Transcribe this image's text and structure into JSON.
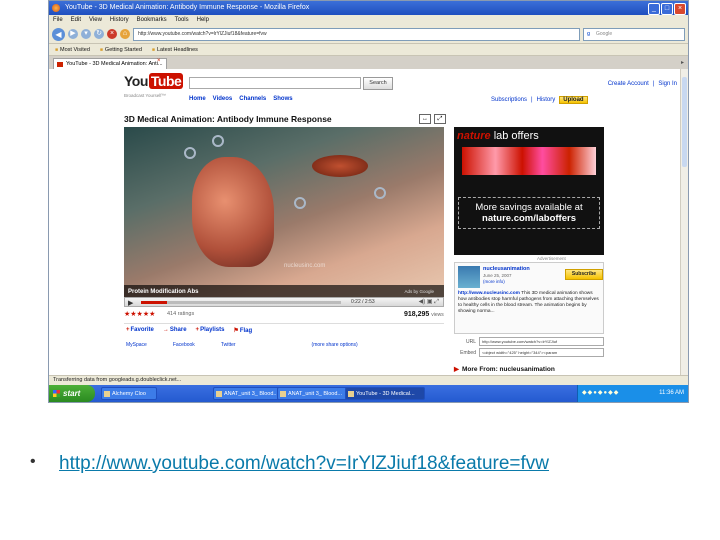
{
  "browser": {
    "title": "YouTube - 3D Medical Animation: Antibody Immune Response - Mozilla Firefox",
    "menu": [
      "File",
      "Edit",
      "View",
      "History",
      "Bookmarks",
      "Tools",
      "Help"
    ],
    "url": "http://www.youtube.com/watch?v=lrYlZJiuf18&feature=fvw",
    "search_placeholder": "Google",
    "bookmarks": [
      "Most Visited",
      "Getting Started",
      "Latest Headlines"
    ],
    "tab_label": "YouTube - 3D Medical Animation: Anti...",
    "status": "Transferring data from googleads.g.doubleclick.net..."
  },
  "youtube": {
    "logo_you": "You",
    "logo_tube": "Tube",
    "tagline": "Broadcast Yourself™",
    "search_button": "Search",
    "nav": [
      "Home",
      "Videos",
      "Channels",
      "Shows"
    ],
    "create_account": "Create Account",
    "sign_in": "Sign In",
    "subscriptions": "Subscriptions",
    "history": "History",
    "upload": "Upload",
    "video_title": "3D Medical Animation: Antibody Immune Response",
    "video_caption": "Protein Modification Abs",
    "ads_by": "Ads by Google",
    "watermark": "nucleusinc.com",
    "time": "0:22 / 2:53",
    "progress": 0.13,
    "stars": "★★★★★",
    "ratings": "414 ratings",
    "views": "918,295",
    "views_label": "views",
    "actions": [
      "Favorite",
      "Share",
      "Playlists",
      "Flag"
    ],
    "share_links": [
      "MySpace",
      "Facebook",
      "Twitter",
      "(more share options)"
    ]
  },
  "ad": {
    "brand": "nature",
    "offers": "lab offers",
    "line1": "More savings available at",
    "line2": "nature.com/laboffers",
    "label": "Advertisement"
  },
  "channel": {
    "name": "nucleusanimation",
    "date": "June 25, 2007",
    "more": "(more info)",
    "subscribe": "Subscribe",
    "desc_link": "http://www.nucleusinc.com",
    "description": " This 3D medical animation shows how antibodies stop harmful pathogens from attaching themselves to healthy cells in the blood stream. The animation begins by showing norma...",
    "url_label": "URL",
    "url_value": "http://www.youtube.com/watch?v=lrYlZJiuf",
    "embed_label": "Embed",
    "embed_value": "<object width=\"425\" height=\"344\"><param",
    "more_from": "More From: nucleusanimation"
  },
  "taskbar": {
    "start": "start",
    "tasks": [
      "Alchemy Cloo",
      "ANAT_unit 3_ Blood...",
      "ANAT_unit 3_ Blood...",
      "YouTube - 3D Medical..."
    ],
    "clock": "11:36 AM"
  },
  "slide": {
    "bullet": "•",
    "link": "http://www.youtube.com/watch?v=IrYlZJiuf18&feature=fvw"
  }
}
